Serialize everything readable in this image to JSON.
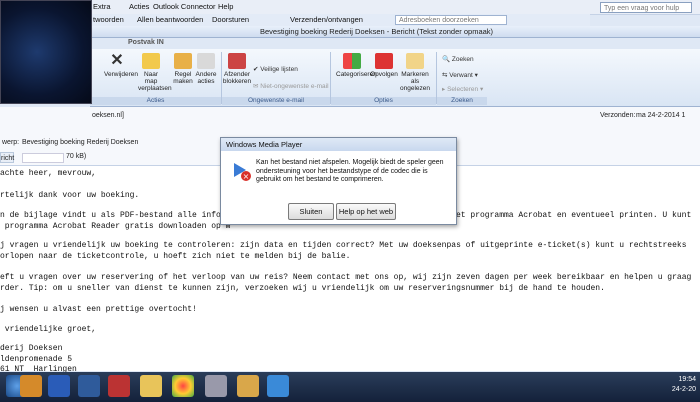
{
  "menubar": {
    "items": [
      {
        "label": "twoorden"
      },
      {
        "label": "Allen beantwoorden"
      },
      {
        "label": "Doorsturen"
      },
      {
        "label": "Verzenden/ontvangen"
      },
      {
        "label": "Adresboeken doorzoeken"
      }
    ],
    "top_menus": [
      {
        "label": "Extra"
      },
      {
        "label": "Acties"
      },
      {
        "label": "Outlook Connector"
      },
      {
        "label": "Help"
      }
    ],
    "help_placeholder": "Typ een vraag voor hulp"
  },
  "window": {
    "title": "Bevestiging boeking Rederij Doeksen - Bericht (Tekst zonder opmaak)",
    "postvak": "Postvak IN"
  },
  "ribbon": {
    "buttons": [
      {
        "label": "Verwijderen"
      },
      {
        "label": "Naar map verplaatsen"
      },
      {
        "label": "Regel maken"
      },
      {
        "label": "Andere acties"
      },
      {
        "label": "Afzender blokkeren"
      },
      {
        "label": "Categoriseren"
      },
      {
        "label": "Opvolgen"
      },
      {
        "label": "Markeren als ongelezen"
      }
    ],
    "small": {
      "veilige_lijsten": "Veilige lijsten",
      "niet_ongewenst": "Niet-ongewenste e-mail",
      "zoeken": "Zoeken",
      "verwant": "Verwant",
      "selecteren": "Selecteren"
    },
    "groups": {
      "acties": "Acties",
      "ongewenste": "Ongewenste e-mail",
      "opties": "Opties",
      "zoeken": "Zoeken"
    }
  },
  "header": {
    "from_fragment": "oeksen.nl]",
    "verzonden_label": "Verzonden:",
    "verzonden_value": "ma 24-2-2014 1",
    "subject_label": "werp:",
    "subject_value": "Bevestiging boeking Rederij Doeksen",
    "bericht_label": "richt",
    "attachment_size": "70 kB)"
  },
  "body_lines": [
    "achte heer, mevrouw,",
    "rtelijk dank voor uw boeking.",
    "n de bijlage vindt u als PDF-bestand alle informa",
    " programma Acrobat Reader gratis downloaden op w",
    "j vragen u vriendelijk uw boeking te controleren: zijn data en tijden correct? Met uw doeksenpas of uitgeprinte e-ticket(s) kunt u rechtstreeks",
    "orlopen naar de ticketcontrole, u hoeft zich niet te melden bij de balie.",
    "eft u vragen over uw reservering of het verloop van uw reis? Neem contact met ons op, wij zijn zeven dagen per week bereikbaar en helpen u graag",
    "rder. Tip: om u sneller van dienst te kunnen zijn, verzoeken wij u vriendelijk om uw reserveringsnummer bij de hand te houden.",
    "j wensen u alvast een prettige overtocht!",
    " vriendelijke groet,",
    "derij Doeksen",
    "ldenpromenade 5",
    "61 NT  Harlingen"
  ],
  "body_right_fragment": "et programma Acrobat en eventueel printen. U kunt",
  "dialog": {
    "title": "Windows Media Player",
    "message": "Kan het bestand niet afspelen. Mogelijk biedt de speler geen ondersteuning voor het bestandstype of de codec die is gebruikt om het bestand te comprimeren.",
    "btn_close": "Sluiten",
    "btn_help": "Help op het web"
  },
  "taskbar": {
    "time": "19:54",
    "date": "24-2-20"
  },
  "colors": {
    "taskbar": "#1c2b47",
    "ribbon": "#dde7f5",
    "error_red": "#d9312b"
  }
}
